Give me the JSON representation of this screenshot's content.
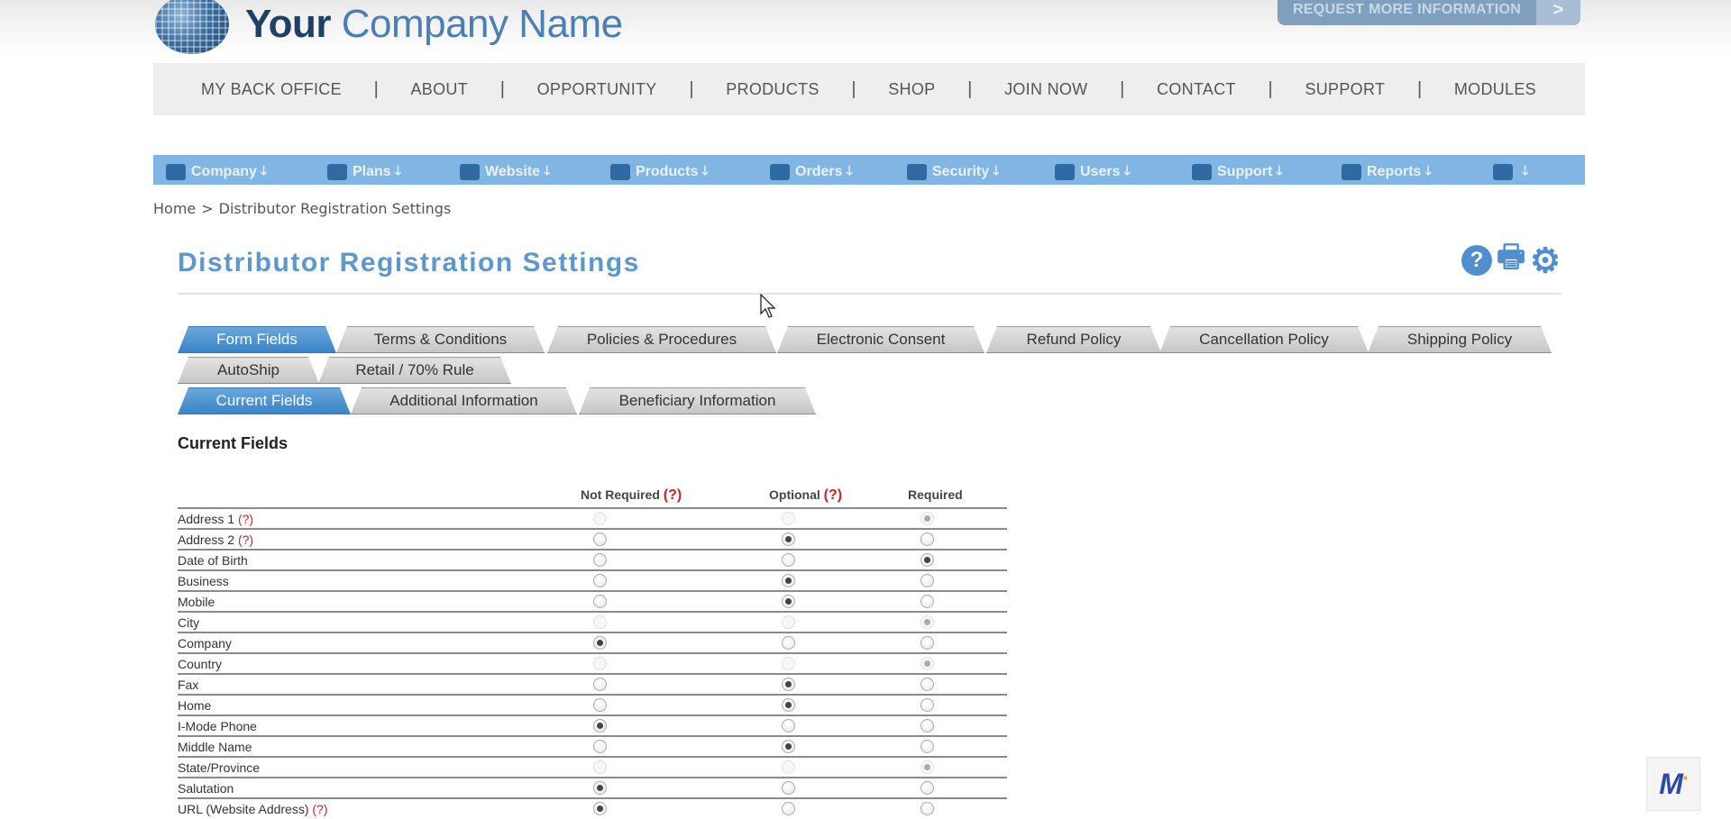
{
  "header": {
    "brand_your": "Your",
    "brand_rest": " Company Name",
    "request_button": "REQUEST MORE INFORMATION",
    "request_arrow": ">"
  },
  "main_nav": [
    "MY BACK OFFICE",
    "ABOUT",
    "OPPORTUNITY",
    "PRODUCTS",
    "SHOP",
    "JOIN NOW",
    "CONTACT",
    "SUPPORT",
    "MODULES"
  ],
  "main_nav_separator": "|",
  "admin_nav": [
    {
      "label": "Company",
      "icon": "briefcase-icon"
    },
    {
      "label": "Plans",
      "icon": "calculator-icon"
    },
    {
      "label": "Website",
      "icon": "monitor-icon"
    },
    {
      "label": "Products",
      "icon": "tags-icon"
    },
    {
      "label": "Orders",
      "icon": "cart-icon"
    },
    {
      "label": "Security",
      "icon": "shield-icon"
    },
    {
      "label": "Users",
      "icon": "users-icon"
    },
    {
      "label": "Support",
      "icon": "medkit-icon"
    },
    {
      "label": "Reports",
      "icon": "bar-chart-icon"
    },
    {
      "label": "",
      "icon": "cogs-icon"
    }
  ],
  "admin_nav_arrow": "🡓",
  "breadcrumb": {
    "home": "Home",
    "sep": ">",
    "current": "Distributor Registration Settings"
  },
  "page": {
    "title": "Distributor Registration Settings",
    "help_icon": "?",
    "print_icon": "🖶",
    "settings_icon": "⚙"
  },
  "tabs_row1": [
    "Form Fields",
    "Terms & Conditions",
    "Policies & Procedures",
    "Electronic Consent",
    "Refund Policy",
    "Cancellation Policy",
    "Shipping Policy"
  ],
  "tabs_row2": [
    "AutoShip",
    "Retail / 70% Rule"
  ],
  "subtabs": [
    "Current Fields",
    "Additional Information",
    "Beneficiary Information"
  ],
  "section_title": "Current Fields",
  "columns": {
    "not_required": "Not Required",
    "optional": "Optional",
    "required": "Required",
    "help": "(?)"
  },
  "fields": [
    {
      "label": "Address 1",
      "help": "(?)",
      "selected": "required",
      "disabled": true
    },
    {
      "label": "Address 2",
      "help": "(?)",
      "selected": "optional",
      "disabled": false
    },
    {
      "label": "Date of Birth",
      "help": "",
      "selected": "required",
      "disabled": false
    },
    {
      "label": "Business",
      "help": "",
      "selected": "optional",
      "disabled": false
    },
    {
      "label": "Mobile",
      "help": "",
      "selected": "optional",
      "disabled": false
    },
    {
      "label": "City",
      "help": "",
      "selected": "required",
      "disabled": true
    },
    {
      "label": "Company",
      "help": "",
      "selected": "not_required",
      "disabled": false
    },
    {
      "label": "Country",
      "help": "",
      "selected": "required",
      "disabled": true
    },
    {
      "label": "Fax",
      "help": "",
      "selected": "optional",
      "disabled": false
    },
    {
      "label": "Home",
      "help": "",
      "selected": "optional",
      "disabled": false
    },
    {
      "label": "I-Mode Phone",
      "help": "",
      "selected": "not_required",
      "disabled": false
    },
    {
      "label": "Middle Name",
      "help": "",
      "selected": "optional",
      "disabled": false
    },
    {
      "label": "State/Province",
      "help": "",
      "selected": "required",
      "disabled": true
    },
    {
      "label": "Salutation",
      "help": "",
      "selected": "not_required",
      "disabled": false
    },
    {
      "label": "URL (Website Address)",
      "help": "(?)",
      "selected": "not_required",
      "disabled": false
    }
  ],
  "badge": {
    "letter": "M"
  }
}
